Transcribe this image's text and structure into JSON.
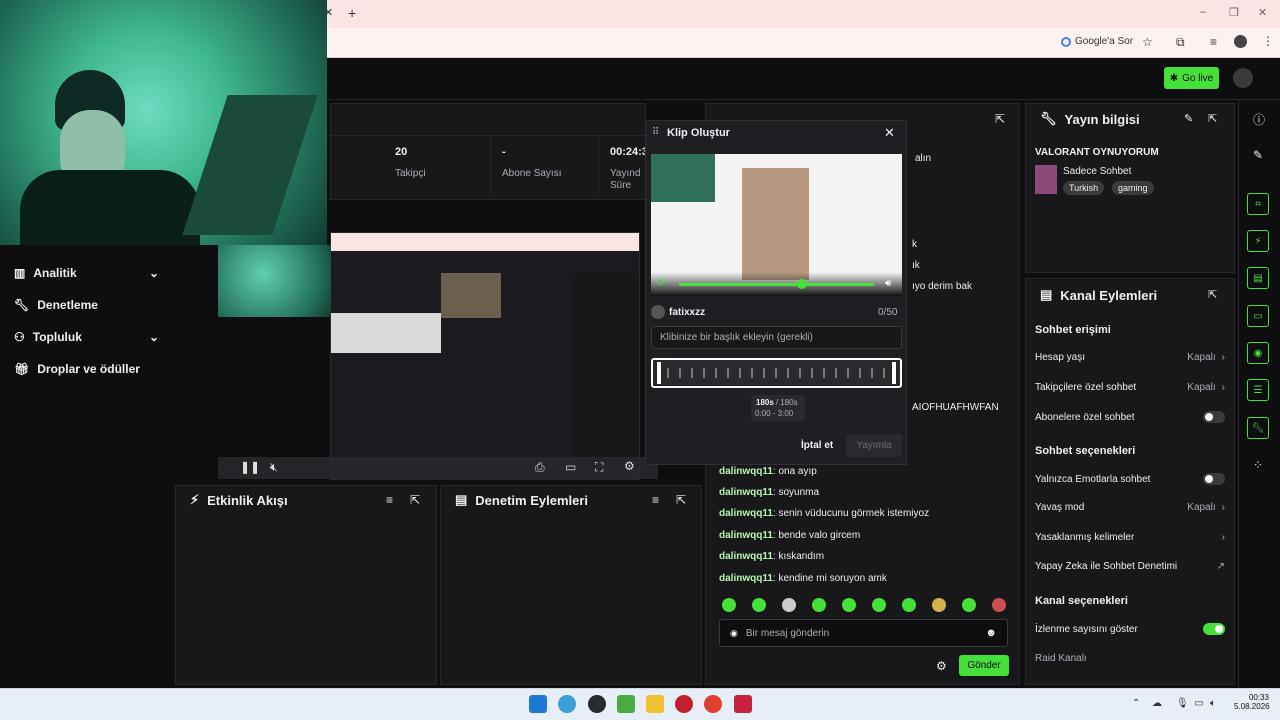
{
  "browser": {
    "new_tab": "+",
    "google_button": "Google'a Sor",
    "win_min": "–",
    "win_max": "❐",
    "win_close": "✕"
  },
  "topnav": {
    "go_live": "Go live"
  },
  "sidebar": {
    "items": [
      {
        "label": "Analitik",
        "icon": "chart-icon",
        "expandable": true
      },
      {
        "label": "Denetleme",
        "icon": "wrench-icon",
        "expandable": false
      },
      {
        "label": "Topluluk",
        "icon": "community-icon",
        "expandable": true
      },
      {
        "label": "Droplar ve ödüller",
        "icon": "gift-icon",
        "expandable": false
      }
    ]
  },
  "stats": {
    "followers_value": "20",
    "followers_label": "Takipçi",
    "subs_value": "-",
    "subs_label": "Abone Sayısı",
    "time_value": "00:24:3",
    "time_label": "Yayınd Süre"
  },
  "clip_modal": {
    "title": "Klip Oluştur",
    "username": "fatixxzz",
    "counter": "0/50",
    "title_placeholder": "Klibinize bir başlık ekleyin (gerekli)",
    "duration": "180s",
    "duration_total": "/ 180s",
    "range": "0:00 - 3:00",
    "cancel": "İptal et",
    "publish": "Yayımla"
  },
  "chat": {
    "partial": [
      "alın",
      "k",
      "ık",
      "ıyo derim bak",
      "AIOFHUAFHWFAN"
    ],
    "messages": [
      {
        "user": "dalinwqq11",
        "text": ": ona ayıp"
      },
      {
        "user": "dalinwqq11",
        "text": ": soyunma"
      },
      {
        "user": "dalinwqq11",
        "text": ": senin vüducunu görmek istemiyoz"
      },
      {
        "user": "dalinwqq11",
        "text": ": bende valo gircem"
      },
      {
        "user": "dalinwqq11",
        "text": ": kıskandım"
      },
      {
        "user": "dalinwqq11",
        "text": ": kendine mi soruyon amk"
      }
    ],
    "input_placeholder": "Bir mesaj gönderin",
    "send": "Gönder"
  },
  "activity": {
    "title": "Etkinlik Akışı"
  },
  "moderation": {
    "title": "Denetim Eylemleri"
  },
  "stream_info": {
    "header": "Yayın bilgisi",
    "title": "VALORANT OYNUYORUM",
    "category": "Sadece Sohbet",
    "tags": [
      "Turkish",
      "gaming"
    ]
  },
  "channel_actions": {
    "header": "Kanal Eylemleri",
    "chat_access": "Sohbet erişimi",
    "account_age": "Hesap yaşı",
    "account_age_val": "Kapalı",
    "followers_only": "Takipçilere özel sohbet",
    "followers_only_val": "Kapalı",
    "subs_only": "Abonelere özel sohbet",
    "chat_options": "Sohbet seçenekleri",
    "emote_only": "Yalnızca Emotlarla sohbet",
    "slow_mode": "Yavaş mod",
    "slow_mode_val": "Kapalı",
    "banned_words": "Yasaklanmış kelimeler",
    "ai_mod": "Yapay Zeka ile Sohbet Denetimi",
    "channel_options": "Kanal seçenekleri",
    "show_viewers": "İzlenme sayısını göster",
    "raid": "Raid Kanalı"
  },
  "taskbar": {
    "time": "00:33",
    "date": "5.08.2026"
  },
  "colors": {
    "accent": "#45e03a",
    "bg": "#0e0e10",
    "panel": "#18181b"
  }
}
